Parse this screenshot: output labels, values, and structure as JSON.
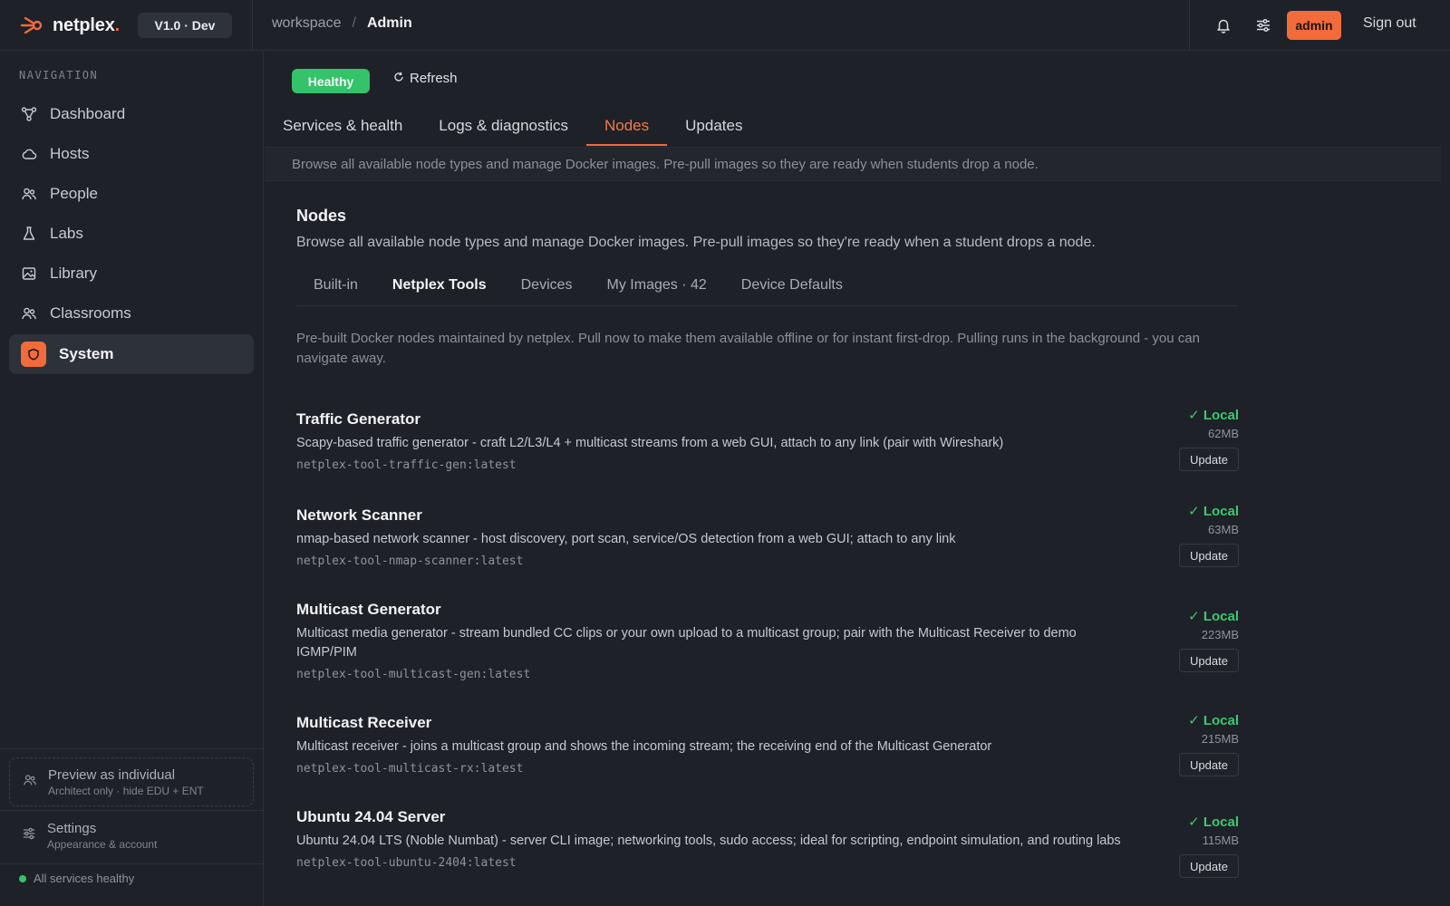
{
  "app": {
    "logo_text": "netplex",
    "logo_dot": ".",
    "version": "V1.0 · Dev"
  },
  "breadcrumb": {
    "root": "workspace",
    "separator": "/",
    "current": "Admin"
  },
  "topbar": {
    "admin_badge": "admin",
    "sign_out": "Sign out",
    "icons": [
      "bell-icon",
      "sliders-icon"
    ]
  },
  "sidebar": {
    "title": "NAVIGATION",
    "items": [
      {
        "label": "Dashboard",
        "icon": "network-icon"
      },
      {
        "label": "Hosts",
        "icon": "cloud-icon"
      },
      {
        "label": "People",
        "icon": "people-icon"
      },
      {
        "label": "Labs",
        "icon": "flask-icon"
      },
      {
        "label": "Library",
        "icon": "image-icon"
      },
      {
        "label": "Classrooms",
        "icon": "classroom-icon"
      },
      {
        "label": "System",
        "icon": "shield-icon",
        "active": true
      }
    ],
    "preview": {
      "title": "Preview as individual",
      "subtitle": "Architect only · hide EDU + ENT"
    },
    "settings": {
      "title": "Settings",
      "subtitle": "Appearance & account"
    },
    "status": "All services healthy"
  },
  "main": {
    "health_badge": "Healthy",
    "refresh_label": "Refresh",
    "tabs": [
      {
        "label": "Services & health"
      },
      {
        "label": "Logs & diagnostics"
      },
      {
        "label": "Nodes",
        "active": true
      },
      {
        "label": "Updates"
      }
    ],
    "tab_description": "Browse all available node types and manage Docker images. Pre-pull images so they are ready when students drop a node.",
    "section_title": "Nodes",
    "section_description": "Browse all available node types and manage Docker images. Pre-pull images so they're ready when a student drops a node.",
    "subtabs": [
      {
        "label": "Built-in"
      },
      {
        "label": "Netplex Tools",
        "active": true
      },
      {
        "label": "Devices"
      },
      {
        "label": "My Images · 42"
      },
      {
        "label": "Device Defaults"
      }
    ],
    "subtab_description": "Pre-built Docker nodes maintained by netplex. Pull now to make them available offline or for instant first-drop. Pulling runs in the background - you can navigate away.",
    "nodes": [
      {
        "name": "Traffic Generator",
        "description": "Scapy-based traffic generator - craft L2/L3/L4 + multicast streams from a web GUI, attach to any link (pair with Wireshark)",
        "image": "netplex-tool-traffic-gen:latest",
        "status": "✓ Local",
        "size": "62MB",
        "action": "Update"
      },
      {
        "name": "Network Scanner",
        "description": "nmap-based network scanner - host discovery, port scan, service/OS detection from a web GUI; attach to any link",
        "image": "netplex-tool-nmap-scanner:latest",
        "status": "✓ Local",
        "size": "63MB",
        "action": "Update"
      },
      {
        "name": "Multicast Generator",
        "description": "Multicast media generator - stream bundled CC clips or your own upload to a multicast group; pair with the Multicast Receiver to demo IGMP/PIM",
        "image": "netplex-tool-multicast-gen:latest",
        "status": "✓ Local",
        "size": "223MB",
        "action": "Update"
      },
      {
        "name": "Multicast Receiver",
        "description": "Multicast receiver - joins a multicast group and shows the incoming stream; the receiving end of the Multicast Generator",
        "image": "netplex-tool-multicast-rx:latest",
        "status": "✓ Local",
        "size": "215MB",
        "action": "Update"
      },
      {
        "name": "Ubuntu 24.04 Server",
        "description": "Ubuntu 24.04 LTS (Noble Numbat) - server CLI image; networking tools, sudo access; ideal for scripting, endpoint simulation, and routing labs",
        "image": "netplex-tool-ubuntu-2404:latest",
        "status": "✓ Local",
        "size": "115MB",
        "action": "Update"
      }
    ]
  },
  "colors": {
    "accent": "#f26b3a",
    "success": "#34c26a",
    "background": "#1e2128"
  }
}
